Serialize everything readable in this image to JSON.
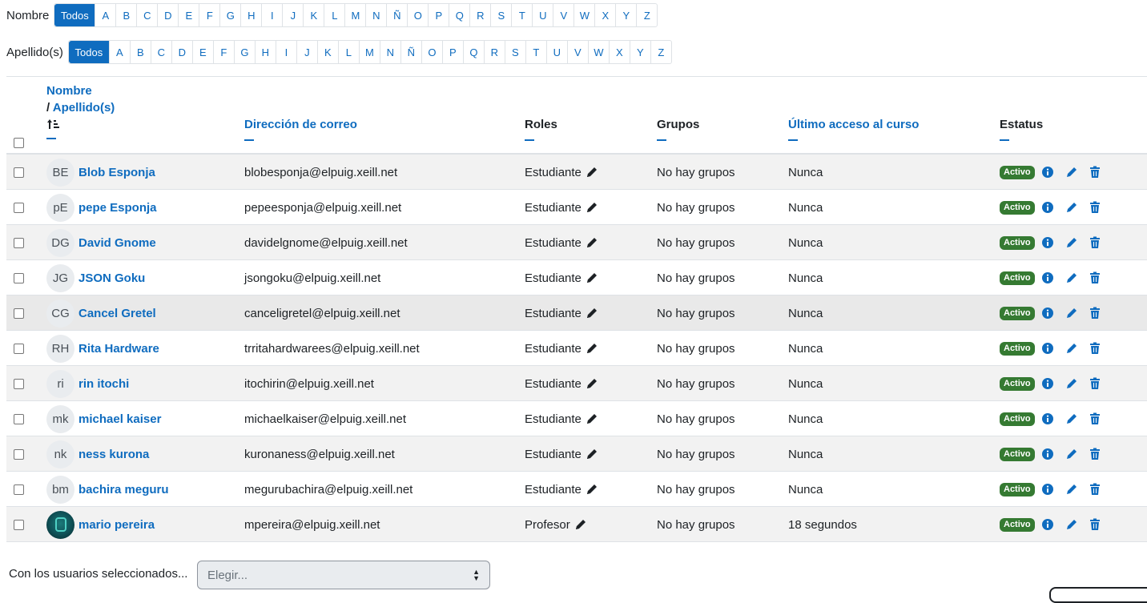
{
  "filters": {
    "firstname_label": "Nombre",
    "lastname_label": "Apellido(s)",
    "all_label": "Todos",
    "letters": [
      "A",
      "B",
      "C",
      "D",
      "E",
      "F",
      "G",
      "H",
      "I",
      "J",
      "K",
      "L",
      "M",
      "N",
      "Ñ",
      "O",
      "P",
      "Q",
      "R",
      "S",
      "T",
      "U",
      "V",
      "W",
      "X",
      "Y",
      "Z"
    ]
  },
  "table": {
    "headers": {
      "firstname": "Nombre",
      "separator": "/",
      "lastname": "Apellido(s)",
      "email": "Dirección de correo",
      "roles": "Roles",
      "groups": "Grupos",
      "last_access": "Último acceso al curso",
      "status": "Estatus"
    },
    "rows": [
      {
        "initials": "BE",
        "name": "Blob Esponja",
        "email": "blobesponja@elpuig.xeill.net",
        "role": "Estudiante",
        "groups": "No hay grupos",
        "last_access": "Nunca",
        "status": "Activo"
      },
      {
        "initials": "pE",
        "name": "pepe Esponja",
        "email": "pepeesponja@elpuig.xeill.net",
        "role": "Estudiante",
        "groups": "No hay grupos",
        "last_access": "Nunca",
        "status": "Activo"
      },
      {
        "initials": "DG",
        "name": "David Gnome",
        "email": "davidelgnome@elpuig.xeill.net",
        "role": "Estudiante",
        "groups": "No hay grupos",
        "last_access": "Nunca",
        "status": "Activo"
      },
      {
        "initials": "JG",
        "name": "JSON Goku",
        "email": "jsongoku@elpuig.xeill.net",
        "role": "Estudiante",
        "groups": "No hay grupos",
        "last_access": "Nunca",
        "status": "Activo"
      },
      {
        "initials": "CG",
        "name": "Cancel Gretel",
        "email": "canceligretel@elpuig.xeill.net",
        "role": "Estudiante",
        "groups": "No hay grupos",
        "last_access": "Nunca",
        "status": "Activo"
      },
      {
        "initials": "RH",
        "name": "Rita Hardware",
        "email": "trritahardwarees@elpuig.xeill.net",
        "role": "Estudiante",
        "groups": "No hay grupos",
        "last_access": "Nunca",
        "status": "Activo"
      },
      {
        "initials": "ri",
        "name": "rin itochi",
        "email": "itochirin@elpuig.xeill.net",
        "role": "Estudiante",
        "groups": "No hay grupos",
        "last_access": "Nunca",
        "status": "Activo"
      },
      {
        "initials": "mk",
        "name": "michael kaiser",
        "email": "michaelkaiser@elpuig.xeill.net",
        "role": "Estudiante",
        "groups": "No hay grupos",
        "last_access": "Nunca",
        "status": "Activo"
      },
      {
        "initials": "nk",
        "name": "ness kurona",
        "email": "kuronaness@elpuig.xeill.net",
        "role": "Estudiante",
        "groups": "No hay grupos",
        "last_access": "Nunca",
        "status": "Activo"
      },
      {
        "initials": "bm",
        "name": "bachira meguru",
        "email": "megurubachira@elpuig.xeill.net",
        "role": "Estudiante",
        "groups": "No hay grupos",
        "last_access": "Nunca",
        "status": "Activo"
      },
      {
        "initials": "",
        "name": "mario pereira",
        "email": "mpereira@elpuig.xeill.net",
        "role": "Profesor",
        "groups": "No hay grupos",
        "last_access": "18 segundos",
        "status": "Activo"
      }
    ]
  },
  "bulk": {
    "label": "Con los usuarios seleccionados...",
    "placeholder": "Elegir..."
  },
  "colors": {
    "link": "#0f6cbf",
    "badge_active": "#357a32"
  }
}
